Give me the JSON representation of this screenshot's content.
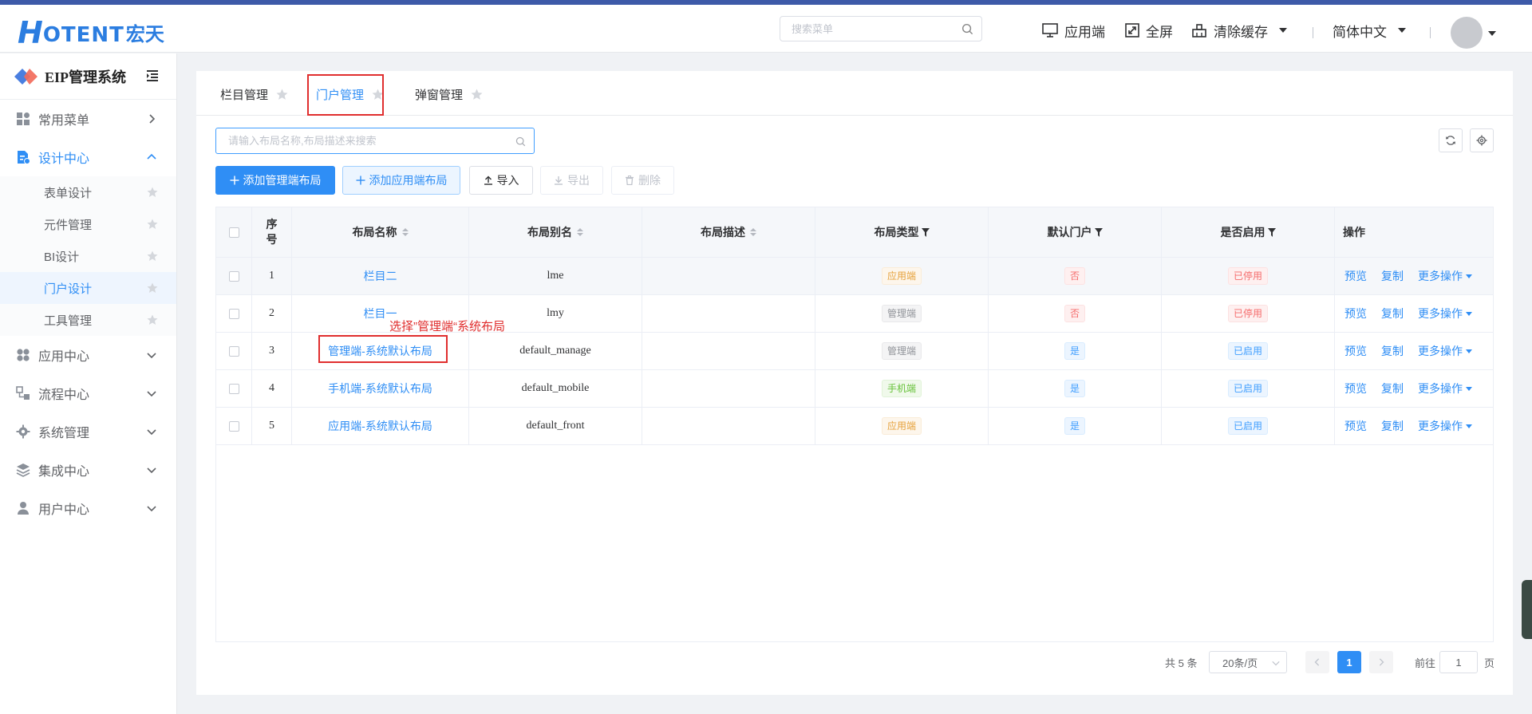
{
  "header": {
    "logo_h": "H",
    "logo_rest": "OTENT",
    "logo_cn": "宏天",
    "search_placeholder": "搜索菜单",
    "app_end": "应用端",
    "fullscreen": "全屏",
    "clear_cache": "清除缓存",
    "language": "简体中文"
  },
  "sidebar": {
    "title": "EIP管理系统",
    "menus": [
      {
        "label": "常用菜单"
      },
      {
        "label": "设计中心"
      },
      {
        "label": "应用中心"
      },
      {
        "label": "流程中心"
      },
      {
        "label": "系统管理"
      },
      {
        "label": "集成中心"
      },
      {
        "label": "用户中心"
      }
    ],
    "sub_items": [
      {
        "label": "表单设计"
      },
      {
        "label": "元件管理"
      },
      {
        "label": "BI设计"
      },
      {
        "label": "门户设计"
      },
      {
        "label": "工具管理"
      }
    ]
  },
  "tabs": [
    {
      "label": "栏目管理"
    },
    {
      "label": "门户管理"
    },
    {
      "label": "弹窗管理"
    }
  ],
  "table_search_placeholder": "请输入布局名称,布局描述来搜索",
  "actions": {
    "add_manage": "添加管理端布局",
    "add_app": "添加应用端布局",
    "import": "导入",
    "export": "导出",
    "delete": "删除"
  },
  "columns": {
    "seq": "序号",
    "name": "布局名称",
    "alias": "布局别名",
    "desc": "布局描述",
    "type": "布局类型",
    "default_portal": "默认门户",
    "enabled": "是否启用",
    "ops": "操作"
  },
  "rows": [
    {
      "seq": "1",
      "name": "栏目二",
      "alias": "lme",
      "desc": "",
      "type": "应用端",
      "default": "否",
      "enabled": "已停用"
    },
    {
      "seq": "2",
      "name": "栏目一",
      "alias": "lmy",
      "desc": "",
      "type": "管理端",
      "default": "否",
      "enabled": "已停用"
    },
    {
      "seq": "3",
      "name": "管理端-系统默认布局",
      "alias": "default_manage",
      "desc": "",
      "type": "管理端",
      "default": "是",
      "enabled": "已启用"
    },
    {
      "seq": "4",
      "name": "手机端-系统默认布局",
      "alias": "default_mobile",
      "desc": "",
      "type": "手机端",
      "default": "是",
      "enabled": "已启用"
    },
    {
      "seq": "5",
      "name": "应用端-系统默认布局",
      "alias": "default_front",
      "desc": "",
      "type": "应用端",
      "default": "是",
      "enabled": "已启用"
    }
  ],
  "row_ops": {
    "preview": "预览",
    "copy": "复制",
    "more": "更多操作"
  },
  "annotation": "选择”管理端“系统布局",
  "pager": {
    "total": "共 5 条",
    "page_size": "20条/页",
    "current": "1",
    "goto_label": "前往",
    "goto_value": "1",
    "page_unit": "页"
  },
  "colors": {
    "accent": "#2f8ef5",
    "highlight": "#e02e2e"
  }
}
